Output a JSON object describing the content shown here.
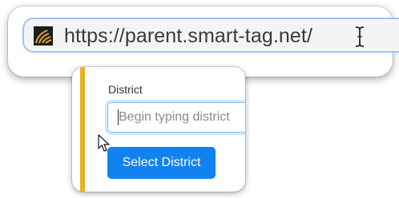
{
  "address_bar": {
    "url": "https://parent.smart-tag.net/",
    "site_icon": "smart-tag-logo-icon",
    "cursor_icon": "text-ibeam-cursor-icon"
  },
  "district_form": {
    "label": "District",
    "input_placeholder": "Begin typing district",
    "input_value": "",
    "select_button_label": "Select District"
  },
  "pointer_icon": "mouse-arrow-cursor-icon",
  "colors": {
    "accent_bar": "#e8b225",
    "button_bg": "#1282f0",
    "focus_border": "#8fbff7"
  }
}
